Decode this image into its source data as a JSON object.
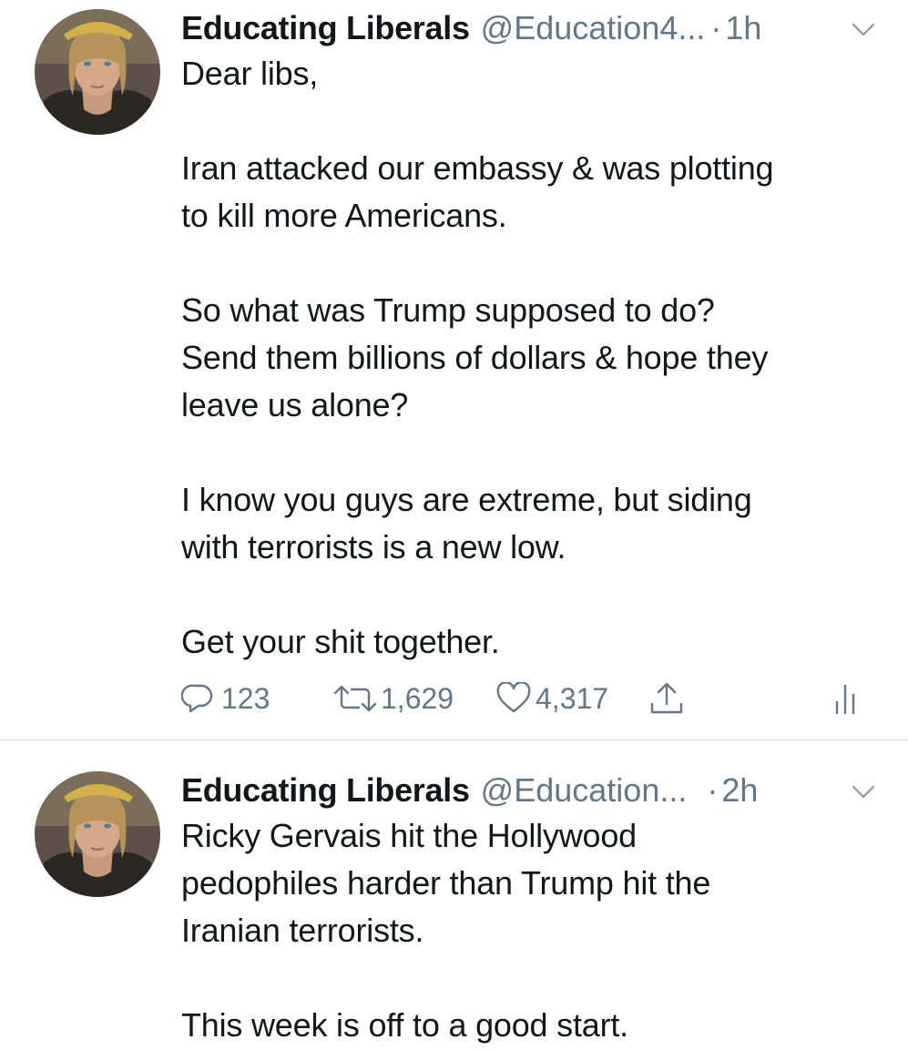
{
  "tweets": [
    {
      "author": {
        "name": "Educating Liberals",
        "handle": "@Education4...",
        "avatar_icon": "profile-photo"
      },
      "separator": "·",
      "time": "1h",
      "paragraphs": [
        [
          "Dear libs,"
        ],
        [
          "Iran attacked our embassy & was plotting",
          "to kill more Americans."
        ],
        [
          "So what was Trump supposed to do?",
          "Send them billions of dollars & hope they",
          "leave us alone?"
        ],
        [
          "I know you guys are extreme, but siding",
          "with terrorists is a new low."
        ],
        [
          "Get your shit together."
        ]
      ],
      "actions": {
        "replies": "123",
        "retweets": "1,629",
        "likes": "4,317"
      }
    },
    {
      "author": {
        "name": "Educating Liberals",
        "handle": "@Education...",
        "avatar_icon": "profile-photo"
      },
      "separator": "·",
      "time": "2h",
      "paragraphs": [
        [
          "Ricky Gervais hit the Hollywood",
          "pedophiles harder than Trump hit the",
          "Iranian terrorists."
        ],
        [
          "This week is off to a good start."
        ]
      ]
    }
  ],
  "icons": {
    "reply": "reply-icon",
    "retweet": "retweet-icon",
    "like": "heart-icon",
    "share": "share-icon",
    "analytics": "analytics-icon",
    "menu": "chevron-down-icon"
  },
  "colors": {
    "text": "#14171a",
    "secondary": "#657786",
    "divider": "#cfd5da",
    "background": "#ffffff"
  }
}
